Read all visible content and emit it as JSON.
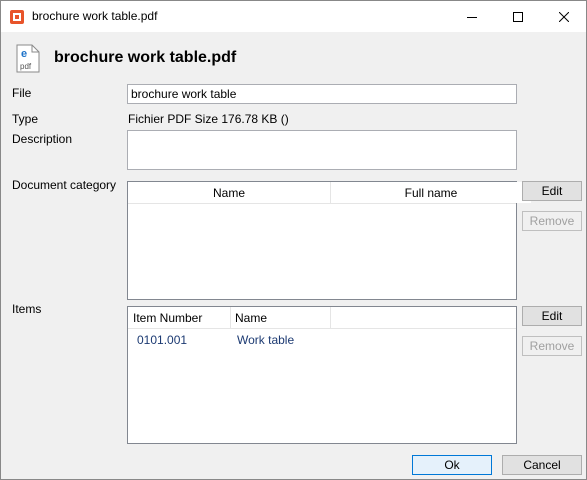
{
  "window": {
    "title": "brochure work table.pdf"
  },
  "header": {
    "title": "brochure work table.pdf",
    "icon_text": "pdf"
  },
  "form": {
    "file_label": "File",
    "file_value": "brochure work table",
    "type_label": "Type",
    "type_value": "Fichier PDF  Size  176.78 KB ()",
    "description_label": "Description",
    "description_value": "",
    "document_category_label": "Document category",
    "items_label": "Items"
  },
  "document_category": {
    "columns": [
      "Name",
      "Full name"
    ],
    "rows": [],
    "edit_label": "Edit",
    "remove_label": "Remove"
  },
  "items": {
    "columns": [
      "Item Number",
      "Name"
    ],
    "rows": [
      {
        "item_number": "0101.001",
        "name": "Work table"
      }
    ],
    "edit_label": "Edit",
    "remove_label": "Remove"
  },
  "footer": {
    "ok_label": "Ok",
    "cancel_label": "Cancel"
  }
}
